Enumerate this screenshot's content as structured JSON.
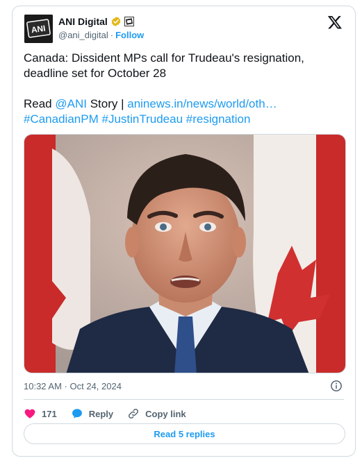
{
  "author": {
    "name": "ANI Digital",
    "avatar_text": "ANI",
    "handle": "@ani_digital",
    "separator": "·",
    "follow_label": "Follow"
  },
  "icons": {
    "verified": "verified-badge-icon",
    "affiliation": "affiliation-badge-icon",
    "platform": "x-logo-icon",
    "info": "info-icon",
    "like": "heart-icon",
    "reply": "reply-bubble-icon",
    "copy_link": "link-icon"
  },
  "tweet": {
    "line1": "Canada: Dissident MPs call for Trudeau's resignation,",
    "line2": "deadline set for October 28",
    "read_prefix": "Read ",
    "mention": "@ANI",
    "story_text": " Story | ",
    "url": "aninews.in/news/world/oth…",
    "hashtag1": "#CanadianPM",
    "hashtag2": "#JustinTrudeau",
    "hashtag3": "#resignation"
  },
  "meta": {
    "timestamp": "10:32 AM · Oct 24, 2024"
  },
  "actions": {
    "like_count": "171",
    "reply_label": "Reply",
    "copy_link_label": "Copy link",
    "read_replies_label": "Read 5 replies"
  },
  "colors": {
    "accent": "#1d9bf0",
    "like": "#f91880",
    "verified": "#e2b719",
    "text": "#0f1419",
    "muted": "#536471",
    "border": "#cfd9de"
  }
}
